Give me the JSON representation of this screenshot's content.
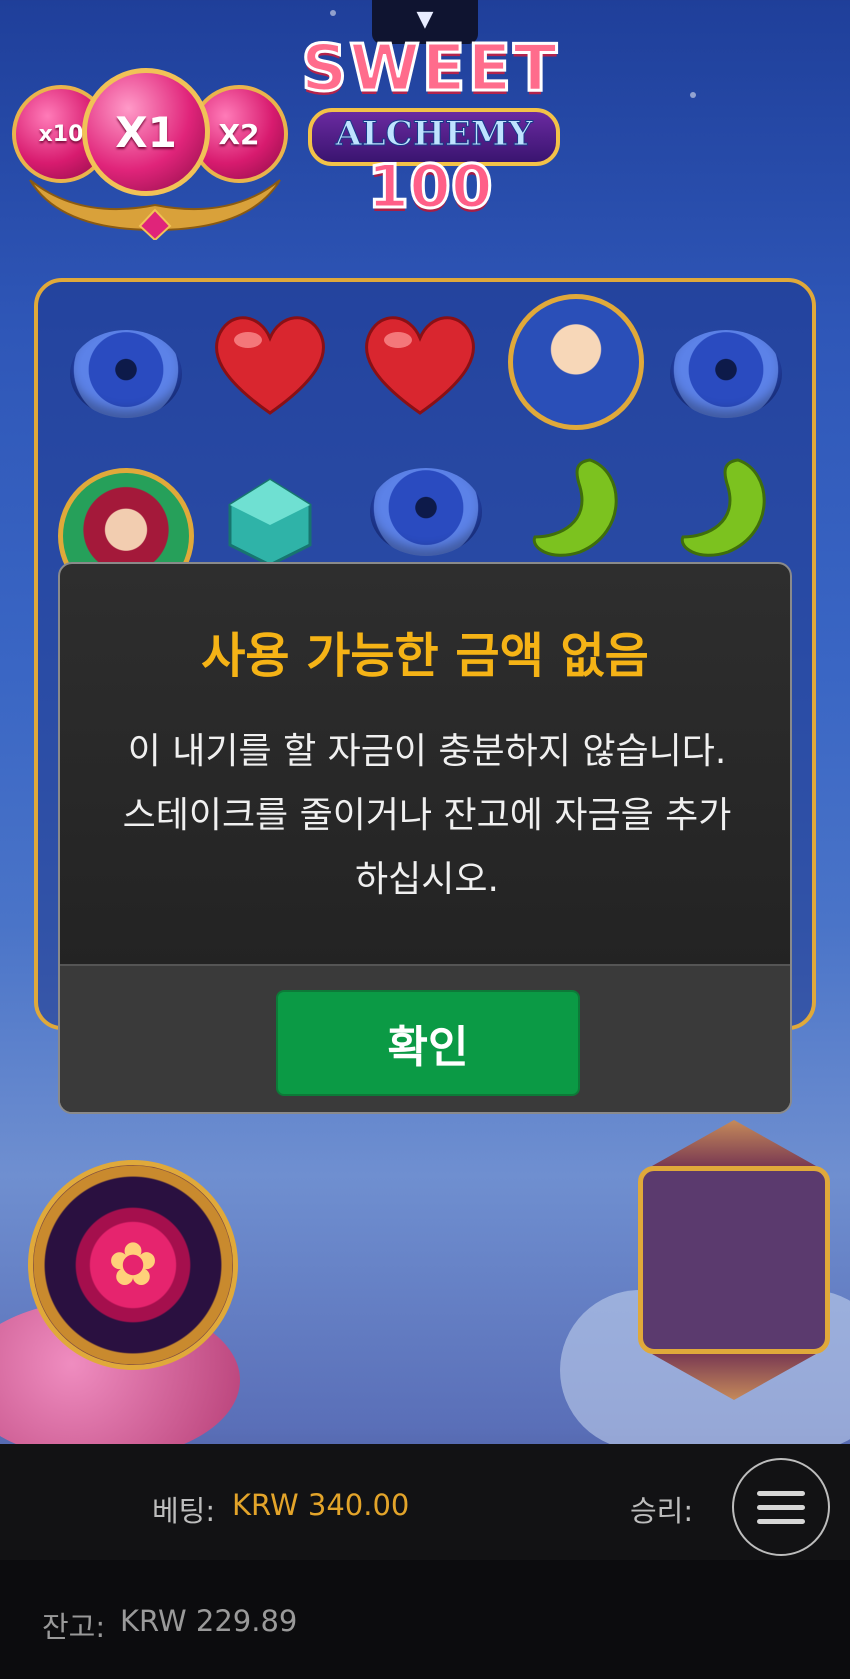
{
  "game": {
    "logo_line1": "SWEET",
    "logo_line2": "ALCHEMY",
    "logo_line3": "100",
    "pull_tab_icon": "▼"
  },
  "multipliers": {
    "left": "x10",
    "center": "X1",
    "right": "X2"
  },
  "modal": {
    "title": "사용 가능한 금액 없음",
    "body_line1": "이 내기를 할 자금이 충분하지 않습니다.",
    "body_line2": "스테이크를 줄이거나 잔고에 자금을 추가",
    "body_line3": "하십시오.",
    "ok_label": "확인"
  },
  "status": {
    "bet_label": "베팅:",
    "bet_value": "KRW 340.00",
    "win_label": "승리:",
    "balance_label": "잔고:",
    "balance_value": "KRW 229.89"
  },
  "colors": {
    "accent_gold": "#f5b316",
    "ok_green": "#0b9a45",
    "bet_value": "#e3a42a"
  }
}
